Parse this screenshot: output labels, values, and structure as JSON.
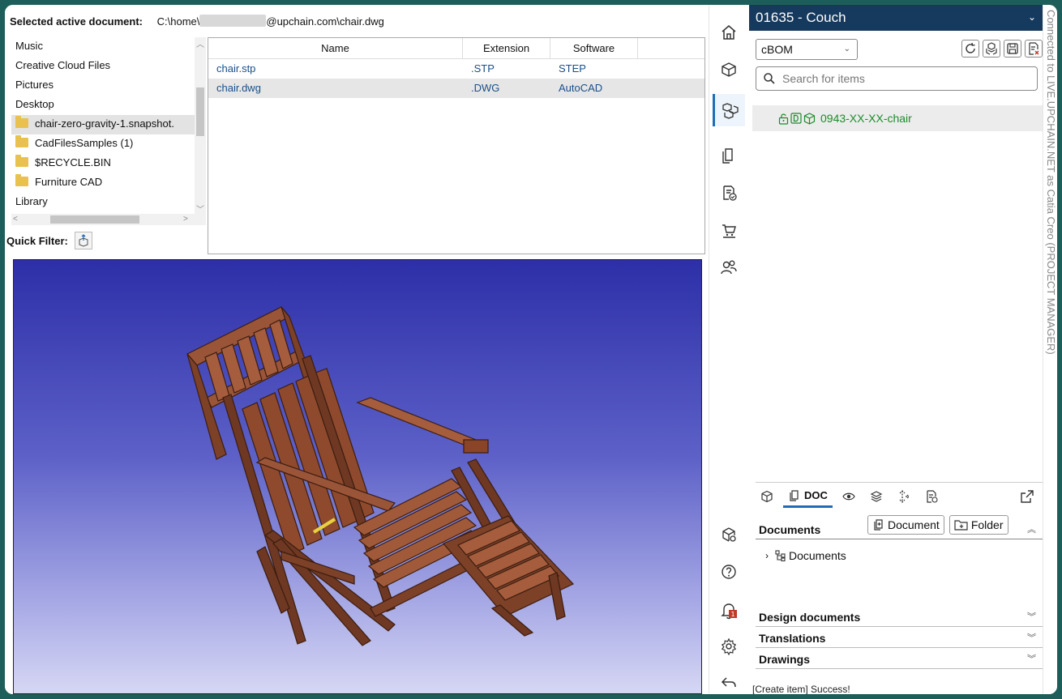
{
  "header": {
    "label": "Selected active document:",
    "path_prefix": "C:\\home\\",
    "path_suffix": "@upchain.com\\chair.dwg"
  },
  "folder_tree": {
    "items": [
      {
        "label": "Music",
        "folder": false
      },
      {
        "label": "Creative Cloud Files",
        "folder": false
      },
      {
        "label": "Pictures",
        "folder": false
      },
      {
        "label": "Desktop",
        "folder": false
      },
      {
        "label": "chair-zero-gravity-1.snapshot.",
        "folder": true
      },
      {
        "label": "CadFilesSamples (1)",
        "folder": true
      },
      {
        "label": "$RECYCLE.BIN",
        "folder": true
      },
      {
        "label": "Furniture CAD",
        "folder": true
      },
      {
        "label": "Library",
        "folder": false
      }
    ],
    "quick_filter_label": "Quick Filter:"
  },
  "file_table": {
    "columns": [
      "Name",
      "Extension",
      "Software"
    ],
    "rows": [
      {
        "name": "chair.stp",
        "extension": ".STP",
        "software": "STEP"
      },
      {
        "name": "chair.dwg",
        "extension": ".DWG",
        "software": "AutoCAD"
      }
    ]
  },
  "panel": {
    "title": "01635 - Couch",
    "view_select": "cBOM",
    "search_placeholder": "Search for items",
    "tree_item": "0943-XX-XX-chair",
    "tab_doc_label": "DOC",
    "documents_section": "Documents",
    "document_button": "Document",
    "folder_button": "Folder",
    "documents_node": "Documents",
    "sections": [
      "Design documents",
      "Translations",
      "Drawings"
    ],
    "status": "[Create item] Success!"
  },
  "rail": {
    "notification_count": "1"
  },
  "connection": "Connected to LIVE.UPCHAIN.NET as Catia Creo (PROJECT MANAGER)",
  "colors": {
    "panel_header": "#163a5e",
    "accent": "#1f6db5",
    "item_green": "#1b8c2b",
    "link_blue": "#1a4f8a",
    "viewer_top": "#2d2fa8",
    "wood": "#8c4a2f"
  }
}
